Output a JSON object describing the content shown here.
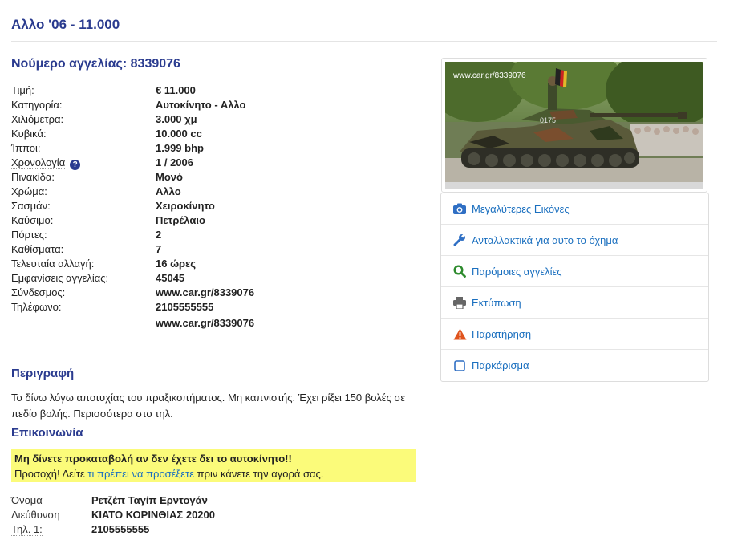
{
  "page_title": "Αλλο '06 - 11.000",
  "ad_number": "Νούμερο αγγελίας: 8339076",
  "specs": [
    {
      "label": "Τιμή:",
      "value": "€ 11.000"
    },
    {
      "label": "Κατηγορία:",
      "value": "Αυτοκίνητο - Αλλο"
    },
    {
      "label": "Χιλιόμετρα:",
      "value": "3.000 χμ"
    },
    {
      "label": "Κυβικά:",
      "value": "10.000 cc"
    },
    {
      "label": "Ίπποι:",
      "value": "1.999 bhp"
    },
    {
      "label": "Χρονολογία",
      "value": "1 / 2006"
    },
    {
      "label": "Πινακίδα:",
      "value": "Μονό"
    },
    {
      "label": "Χρώμα:",
      "value": "Αλλο"
    },
    {
      "label": "Σασμάν:",
      "value": "Χειροκίνητο"
    },
    {
      "label": "Καύσιμο:",
      "value": "Πετρέλαιο"
    },
    {
      "label": "Πόρτες:",
      "value": "2"
    },
    {
      "label": "Καθίσματα:",
      "value": "7"
    },
    {
      "label": "Τελευταία αλλαγή:",
      "value": "16 ώρες"
    },
    {
      "label": "Εμφανίσεις αγγελίας:",
      "value": "45045"
    },
    {
      "label": "Σύνδεσμος:",
      "value": "www.car.gr/8339076"
    },
    {
      "label": "Τηλέφωνο:",
      "value": "2105555555"
    },
    {
      "label": "",
      "value": "www.car.gr/8339076"
    }
  ],
  "description": {
    "title": "Περιγραφή",
    "text": "Το δίνω λόγω αποτυχίας του πραξικοπήματος. Μη καπνιστής. Έχει ρίξει 150 βολές σε πεδίο βολής. Περισσότερα στο τηλ."
  },
  "contact": {
    "title": "Επικοινωνία",
    "warning_strong": "Μη δίνετε προκαταβολή αν δεν έχετε δει το αυτοκίνητο!!",
    "warning_prefix": "Προσοχή! Δείτε ",
    "warning_link": "τι πρέπει να προσέξετε",
    "warning_suffix": " πριν κάνετε την αγορά σας.",
    "rows": [
      {
        "label": "Όνομα",
        "value": "Ρετζέπ Ταγίπ Ερντογάν"
      },
      {
        "label": "Διεύθυνση",
        "value": "ΚΙΑΤΟ ΚΟΡΙΝΘΙΑΣ 20200"
      },
      {
        "label": "Τηλ. 1:",
        "value": "2105555555"
      }
    ]
  },
  "photo": {
    "watermark": "www.car.gr/8339076",
    "tank_number": "0175"
  },
  "menu": [
    {
      "label": "Μεγαλύτερες Εικόνες",
      "icon": "camera-icon",
      "color": "#2f6fc4"
    },
    {
      "label": "Ανταλλακτικά για αυτο το όχημα",
      "icon": "wrench-icon",
      "color": "#2f6fc4"
    },
    {
      "label": "Παρόμοιες αγγελίες",
      "icon": "search-icon",
      "color": "#2e8b2e"
    },
    {
      "label": "Εκτύπωση",
      "icon": "print-icon",
      "color": "#666666"
    },
    {
      "label": "Παρατήρηση",
      "icon": "warning-icon",
      "color": "#e0531c"
    },
    {
      "label": "Παρκάρισμα",
      "icon": "checkbox-icon",
      "color": "#2f6fc4"
    }
  ]
}
